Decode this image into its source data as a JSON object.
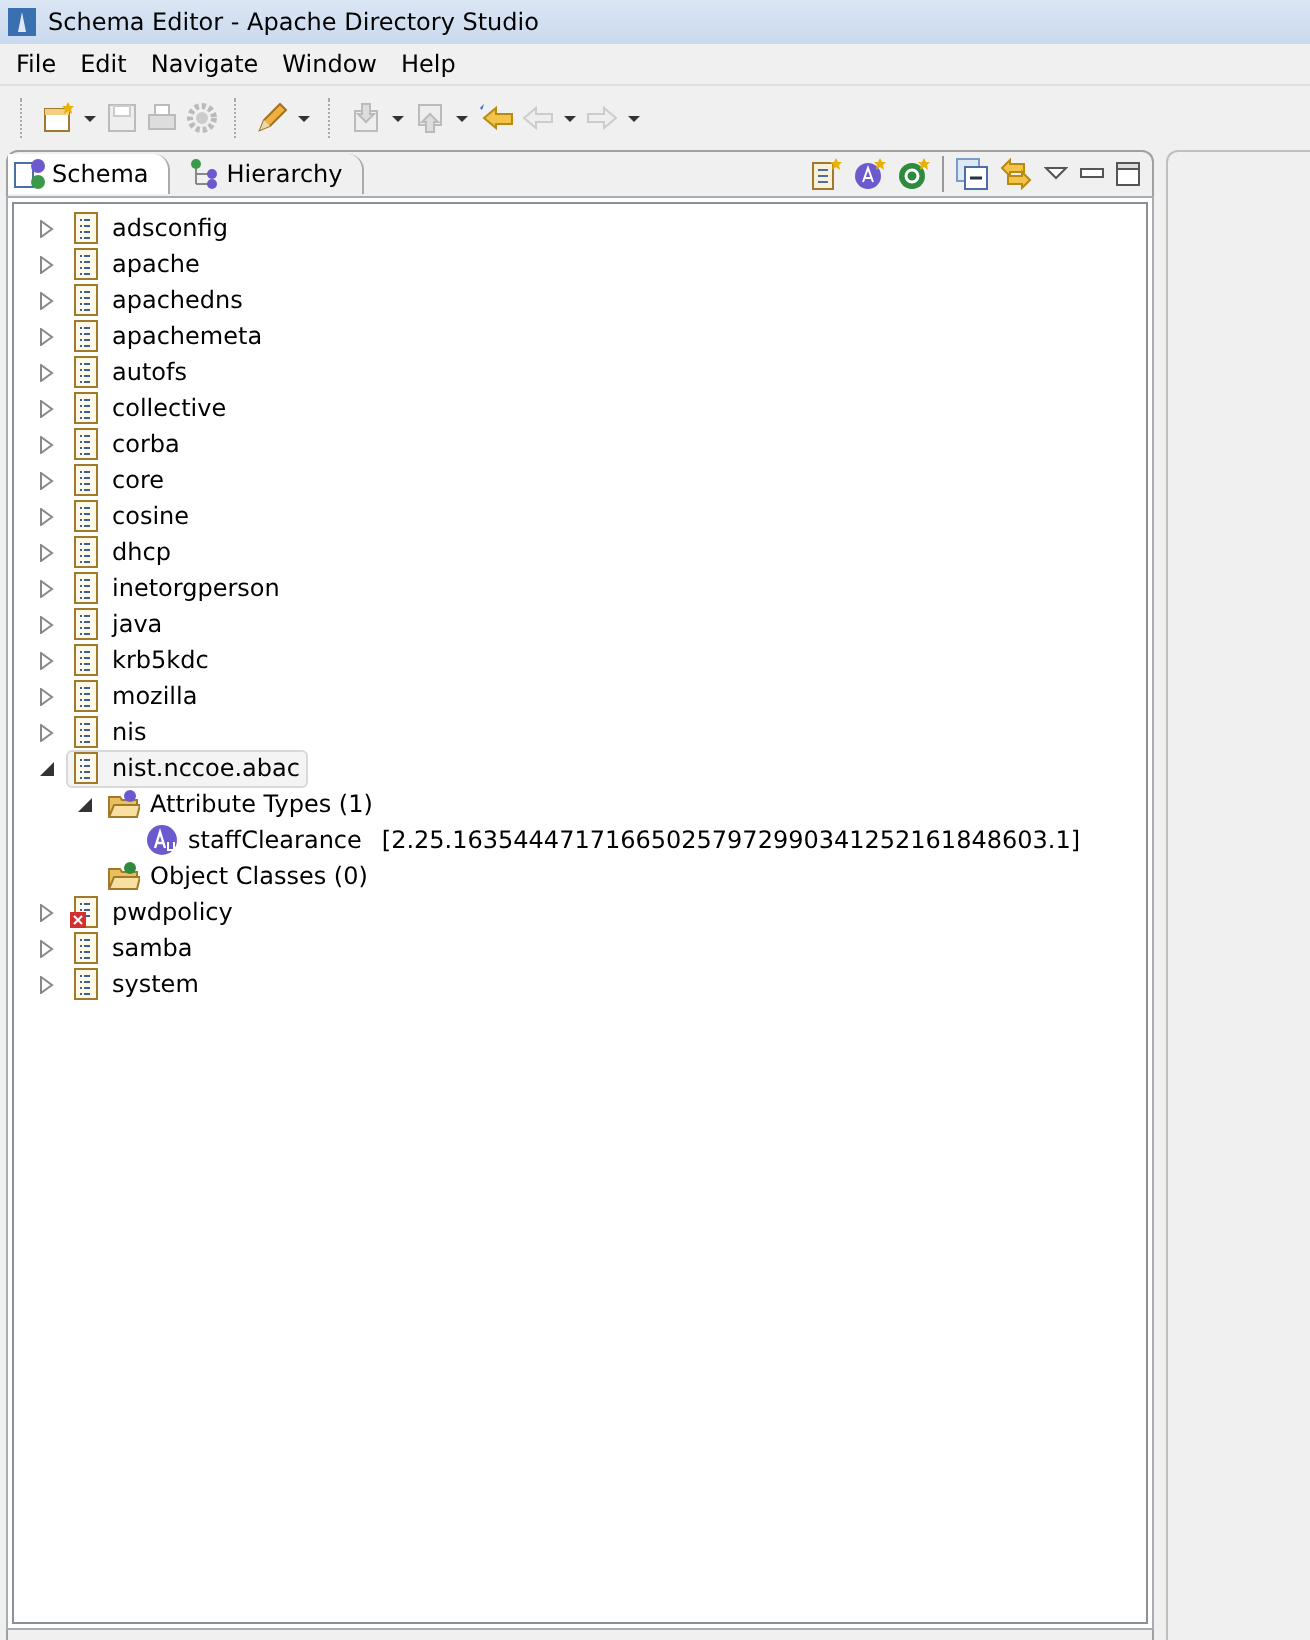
{
  "window": {
    "title": "Schema Editor - Apache Directory Studio"
  },
  "menu": [
    "File",
    "Edit",
    "Navigate",
    "Window",
    "Help"
  ],
  "tabs": [
    {
      "label": "Schema",
      "kind": "schema",
      "selected": true
    },
    {
      "label": "Hierarchy",
      "kind": "hierarchy",
      "selected": false
    }
  ],
  "tree": [
    {
      "label": "adsconfig",
      "kind": "schema",
      "expanded": false,
      "selected": false
    },
    {
      "label": "apache",
      "kind": "schema",
      "expanded": false,
      "selected": false
    },
    {
      "label": "apachedns",
      "kind": "schema",
      "expanded": false,
      "selected": false
    },
    {
      "label": "apachemeta",
      "kind": "schema",
      "expanded": false,
      "selected": false
    },
    {
      "label": "autofs",
      "kind": "schema",
      "expanded": false,
      "selected": false
    },
    {
      "label": "collective",
      "kind": "schema",
      "expanded": false,
      "selected": false
    },
    {
      "label": "corba",
      "kind": "schema",
      "expanded": false,
      "selected": false
    },
    {
      "label": "core",
      "kind": "schema",
      "expanded": false,
      "selected": false
    },
    {
      "label": "cosine",
      "kind": "schema",
      "expanded": false,
      "selected": false
    },
    {
      "label": "dhcp",
      "kind": "schema",
      "expanded": false,
      "selected": false
    },
    {
      "label": "inetorgperson",
      "kind": "schema",
      "expanded": false,
      "selected": false
    },
    {
      "label": "java",
      "kind": "schema",
      "expanded": false,
      "selected": false
    },
    {
      "label": "krb5kdc",
      "kind": "schema",
      "expanded": false,
      "selected": false
    },
    {
      "label": "mozilla",
      "kind": "schema",
      "expanded": false,
      "selected": false
    },
    {
      "label": "nis",
      "kind": "schema",
      "expanded": false,
      "selected": false
    },
    {
      "label": "nist.nccoe.abac",
      "kind": "schema",
      "expanded": true,
      "selected": true,
      "children": [
        {
          "label": "Attribute Types (1)",
          "kind": "attribute-folder",
          "expanded": true,
          "selected": false,
          "children": [
            {
              "label": "staffClearance",
              "oid": "[2.25.163544471716650257972990341252161848603.1]",
              "kind": "attribute",
              "selected": false
            }
          ]
        },
        {
          "label": "Object Classes (0)",
          "kind": "class-folder",
          "selected": false
        }
      ]
    },
    {
      "label": "pwdpolicy",
      "kind": "disabled-schema",
      "expanded": false,
      "selected": false
    },
    {
      "label": "samba",
      "kind": "schema",
      "expanded": false,
      "selected": false
    },
    {
      "label": "system",
      "kind": "schema",
      "expanded": false,
      "selected": false
    }
  ]
}
